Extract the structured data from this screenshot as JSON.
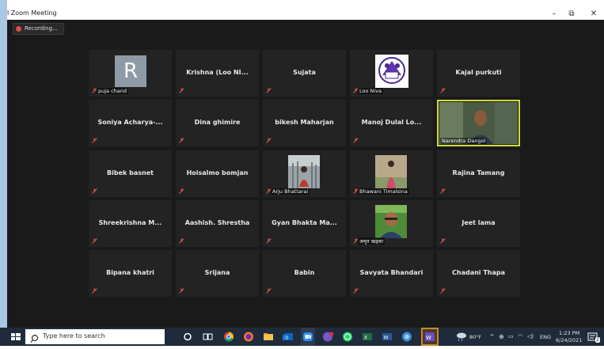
{
  "window": {
    "title": "l Zoom Meeting",
    "minimize": "–",
    "restore": "⧉",
    "close": "✕"
  },
  "recording": {
    "label": "Recording..."
  },
  "participants": [
    {
      "name": "puja chand",
      "avatar_letter": "R",
      "label_style": "bottom"
    },
    {
      "name": "Krishna (Loo NI...",
      "label_style": "center"
    },
    {
      "name": "Sujata",
      "label_style": "center"
    },
    {
      "name": "Loo Niva",
      "label_style": "bottom"
    },
    {
      "name": "Kajal purkuti",
      "label_style": "center"
    },
    {
      "name": "Soniya Acharya-...",
      "label_style": "center"
    },
    {
      "name": "Dina ghimire",
      "label_style": "center"
    },
    {
      "name": "bikesh Maharjan",
      "label_style": "center"
    },
    {
      "name": "Manoj Dulal Lo...",
      "label_style": "center"
    },
    {
      "name": "Narendra Dangol",
      "label_style": "bottom",
      "active_speaker": true
    },
    {
      "name": "Bibek basnet",
      "label_style": "center"
    },
    {
      "name": "Hoisalmo bomjan",
      "label_style": "center"
    },
    {
      "name": "Arju Bhattarai",
      "label_style": "bottom"
    },
    {
      "name": "Bhawani Timalsina",
      "label_style": "bottom"
    },
    {
      "name": "Rajina Tamang",
      "label_style": "center"
    },
    {
      "name": "Shreekrishna M...",
      "label_style": "center"
    },
    {
      "name": "Aashish. Shrestha",
      "label_style": "center"
    },
    {
      "name": "Gyan Bhakta Ma...",
      "label_style": "center"
    },
    {
      "name": "अमृत खड्का",
      "label_style": "bottom"
    },
    {
      "name": "Jeet lama",
      "label_style": "center"
    },
    {
      "name": "Bipana khatri",
      "label_style": "center"
    },
    {
      "name": "Srijana",
      "label_style": "center"
    },
    {
      "name": "Babin",
      "label_style": "center"
    },
    {
      "name": "Savyata Bhandari",
      "label_style": "center"
    },
    {
      "name": "Chadani Thapa",
      "label_style": "center"
    }
  ],
  "taskbar": {
    "search_placeholder": "Type here to search",
    "weather": "80°F",
    "language": "ENG",
    "time": "1:23 PM",
    "date": "6/24/2021",
    "notification_count": "2"
  },
  "colors": {
    "active_speaker_border": "#cddc39",
    "muted_mic": "#d9534f",
    "recording_dot": "#e04a4a"
  }
}
